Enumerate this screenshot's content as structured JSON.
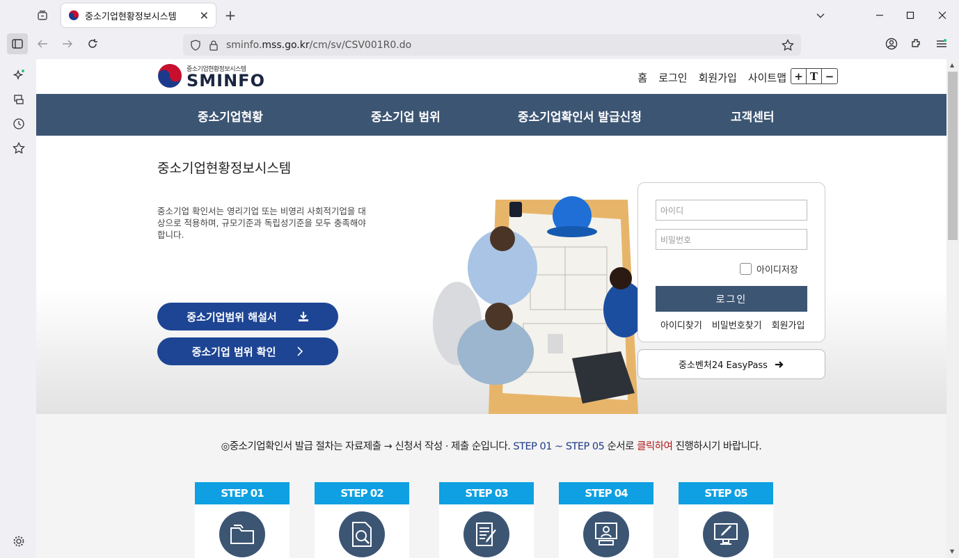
{
  "browser": {
    "tab_title": "중소기업현황정보시스템",
    "url_prefix": "sminfo.",
    "url_domain": "mss.go.kr",
    "url_path": "/cm/sv/CSV001R0.do"
  },
  "site": {
    "logo_small": "중소기업현황정보시스템",
    "logo_big": "SMINFO",
    "top_links": [
      "홈",
      "로그인",
      "회원가입",
      "사이트맵"
    ],
    "font_controls": [
      "+",
      "T",
      "−"
    ],
    "gnb": [
      "중소기업현황",
      "중소기업 범위",
      "중소기업확인서 발급신청",
      "고객센터"
    ],
    "hero_title": "중소기업현황정보시스템",
    "hero_desc": "중소기업 확인서는 영리기업 또는 비영리 사회적기업을 대상으로 적용하며, 규모기준과 독립성기준을 모두 충족해야 합니다.",
    "btn_guide": "중소기업범위 해설서",
    "btn_check": "중소기업 범위 확인",
    "login": {
      "id_placeholder": "아이디",
      "pw_placeholder": "비밀번호",
      "save_id": "아이디저장",
      "login_btn": "로그인",
      "links": [
        "아이디찾기",
        "비밀번호찾기",
        "회원가입"
      ]
    },
    "easypass": "중소벤처24 EasyPass",
    "notice": {
      "part1": "◎중소기업확인서 발급 절차는 자료제출 → 신청서 작성 · 제출 순입니다. ",
      "part2": "STEP 01 ~ STEP 05",
      "part3": " 순서로 ",
      "part4": "클릭하여",
      "part5": " 진행하시기 바랍니다."
    },
    "steps": [
      "STEP 01",
      "STEP 02",
      "STEP 03",
      "STEP 04",
      "STEP 05"
    ]
  },
  "colors": {
    "gnb": "#3c5573",
    "primary_button": "#1d4594",
    "step_header": "#0ea0e2"
  }
}
